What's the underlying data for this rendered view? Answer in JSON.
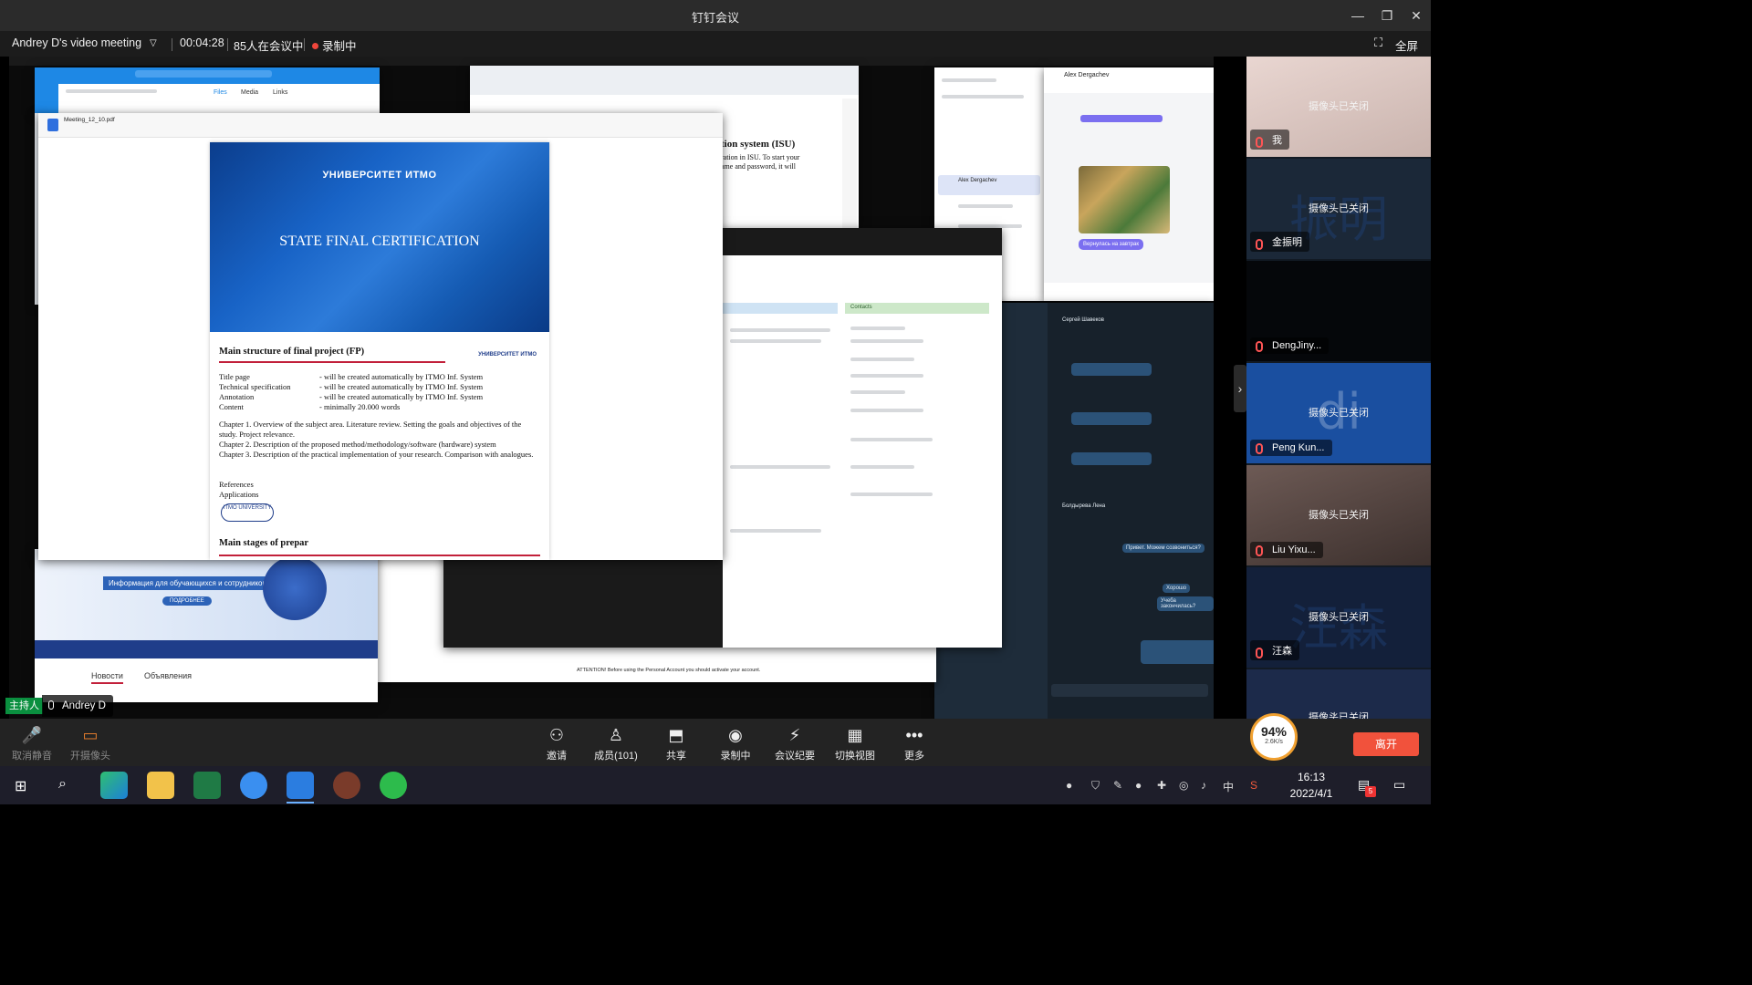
{
  "app": {
    "title": "钉钉会议"
  },
  "meeting": {
    "name": "Andrey D's video meeting",
    "duration": "00:04:28",
    "attendees": "85人在会议中",
    "recording": "录制中",
    "fullscreen": "全屏"
  },
  "shared": {
    "pdf_filename": "Meeting_12_10.pdf",
    "slide1_brand": "УНИВЕРСИТЕТ ИТМО",
    "slide1_title": "STATE FINAL CERTIFICATION",
    "slide2_title": "Main structure of final project (FP)",
    "slide2_brand": "УНИВЕРСИТЕТ ИТМО",
    "slide2_rows": [
      {
        "label": "Title page",
        "value": "- will be created automatically by ITMO Inf. System"
      },
      {
        "label": "Technical specification",
        "value": "- will be created automatically by ITMO Inf. System"
      },
      {
        "label": "Annotation",
        "value": "- will be created automatically by ITMO Inf. System"
      },
      {
        "label": "Content",
        "value": "- minimally 20.000 words"
      }
    ],
    "slide2_ch1": "Chapter 1. Overview of the subject area. Literature review. Setting the goals and objectives of the study. Project relevance.",
    "slide2_ch2": "Chapter 2. Description of the proposed method/methodology/software (hardware) system",
    "slide2_ch3": "Chapter 3. Description of the practical implementation of your research. Comparison with analogues.",
    "slide2_refs": "References",
    "slide2_apps": "Applications",
    "slide2_oval": "ITMO UNIVERSITY",
    "slide3_title": "Main stages of prepar",
    "isu_title": "tion system (ISU)",
    "isu_line1": "ration in ISU. To start your",
    "isu_line2": "ame and password, it will",
    "tg_contact": "Alex Dergachev",
    "tg_status": "Вернулась на завтрак",
    "tg_dark_contact": "Сергей Шавеков",
    "tg_dark_contact2": "Болдырева Лена",
    "tg_msg1": "Привет. Можем созвониться?",
    "tg_msg2": "Хорошо",
    "tg_msg3": "Учеба закончилась?",
    "browser_contacts": "Contacts",
    "browser_news": "Новости",
    "browser_ads": "Объявления",
    "covid_banner": "Информация для обучающихся и сотрудников",
    "covid_button": "ПОДРОБНЕЕ",
    "attention": "ATTENTION! Before using the Personal Account you should activate your account."
  },
  "participants": [
    {
      "name": "我",
      "status": "摄像头已关闭",
      "watermark": ""
    },
    {
      "name": "金振明",
      "status": "摄像头已关闭",
      "watermark": "振明"
    },
    {
      "name": "DengJiny...",
      "status": "",
      "watermark": ""
    },
    {
      "name": "Peng Kun...",
      "status": "摄像头已关闭",
      "watermark": "di"
    },
    {
      "name": "Liu Yixu...",
      "status": "摄像头已关闭",
      "watermark": ""
    },
    {
      "name": "汪森",
      "status": "摄像头已关闭",
      "watermark": "汪森"
    },
    {
      "name": "",
      "status": "摄像头已关闭",
      "watermark": ""
    }
  ],
  "host": {
    "badge": "主持人",
    "name": "Andrey D"
  },
  "controls": {
    "mute": "取消静音",
    "camera": "开摄像头",
    "invite": "邀请",
    "members": "成员(101)",
    "share": "共享",
    "record": "录制中",
    "minutes": "会议纪要",
    "layout": "切换视图",
    "more": "更多",
    "leave": "离开"
  },
  "network": {
    "quality": "94%",
    "speed": "2.6K/s"
  },
  "taskbar": {
    "time": "16:13",
    "date": "2022/4/1",
    "notifications": "5"
  },
  "colors": {
    "record": "#f0463c",
    "leave": "#f1523c",
    "host": "#0a8f3f"
  }
}
